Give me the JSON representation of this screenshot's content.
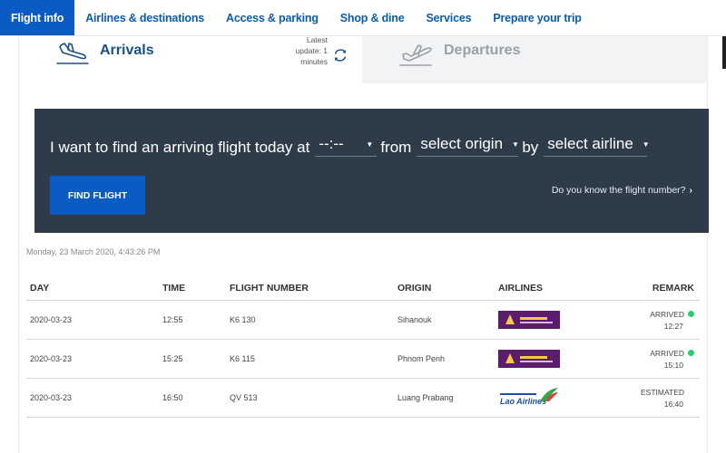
{
  "nav": {
    "items": [
      {
        "label": "Flight info",
        "active": true
      },
      {
        "label": "Airlines & destinations",
        "active": false
      },
      {
        "label": "Access & parking",
        "active": false
      },
      {
        "label": "Shop & dine",
        "active": false
      },
      {
        "label": "Services",
        "active": false
      },
      {
        "label": "Prepare your trip",
        "active": false
      }
    ]
  },
  "tabs": {
    "arrivals": {
      "label": "Arrivals",
      "icon": "arrival-plane-icon"
    },
    "departures": {
      "label": "Departures",
      "icon": "departure-plane-icon"
    },
    "update_line1": "Latest",
    "update_line2": "update: 1",
    "update_line3": "minutes"
  },
  "search": {
    "prefix": "I want to find an arriving flight today at",
    "time_value": "--:--",
    "from_word": "from",
    "origin_value": "select origin",
    "by_word": "by",
    "airline_value": "select airline",
    "find_button": "FIND FLIGHT",
    "know_link": "Do you know the flight number?"
  },
  "timestamp": "Monday, 23 March 2020, 4:43:26 PM",
  "table": {
    "headers": {
      "day": "DAY",
      "time": "TIME",
      "flight": "FLIGHT NUMBER",
      "origin": "ORIGIN",
      "airlines": "AIRLINES",
      "remark": "REMARK"
    },
    "rows": [
      {
        "day": "2020-03-23",
        "time": "12:55",
        "flight": "K6 130",
        "origin": "Sihanouk",
        "airline_logo": "cambodia-angkor-air-logo",
        "remark_status": "ARRIVED",
        "remark_time": "12:27",
        "dot": true
      },
      {
        "day": "2020-03-23",
        "time": "15:25",
        "flight": "K6 115",
        "origin": "Phnom Penh",
        "airline_logo": "cambodia-angkor-air-logo",
        "remark_status": "ARRIVED",
        "remark_time": "15:10",
        "dot": true
      },
      {
        "day": "2020-03-23",
        "time": "16:50",
        "flight": "QV 513",
        "origin": "Luang Prabang",
        "airline_logo": "lao-airlines-logo",
        "airline_name": "Lao Airlines",
        "remark_status": "ESTIMATED",
        "remark_time": "16:40",
        "dot": false
      }
    ]
  },
  "colors": {
    "nav_active": "#0a5bc4",
    "search_panel": "#2e3c4a",
    "arrived_dot": "#2ecc71"
  }
}
